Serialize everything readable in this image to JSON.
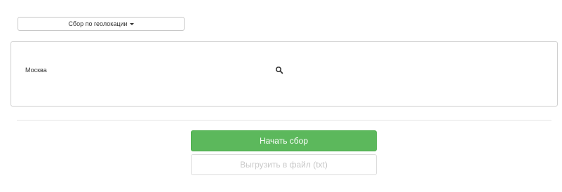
{
  "mode_dropdown": {
    "label": "Сбор по геолокации",
    "icon": "caret-down-icon"
  },
  "search": {
    "value": "Москва",
    "icon": "search-icon"
  },
  "actions": {
    "start_label": "Начать сбор",
    "export_label": "Выгрузить в файл (txt)"
  },
  "colors": {
    "start_button": "#5cb85c",
    "export_button_text": "#c9c9c9"
  }
}
